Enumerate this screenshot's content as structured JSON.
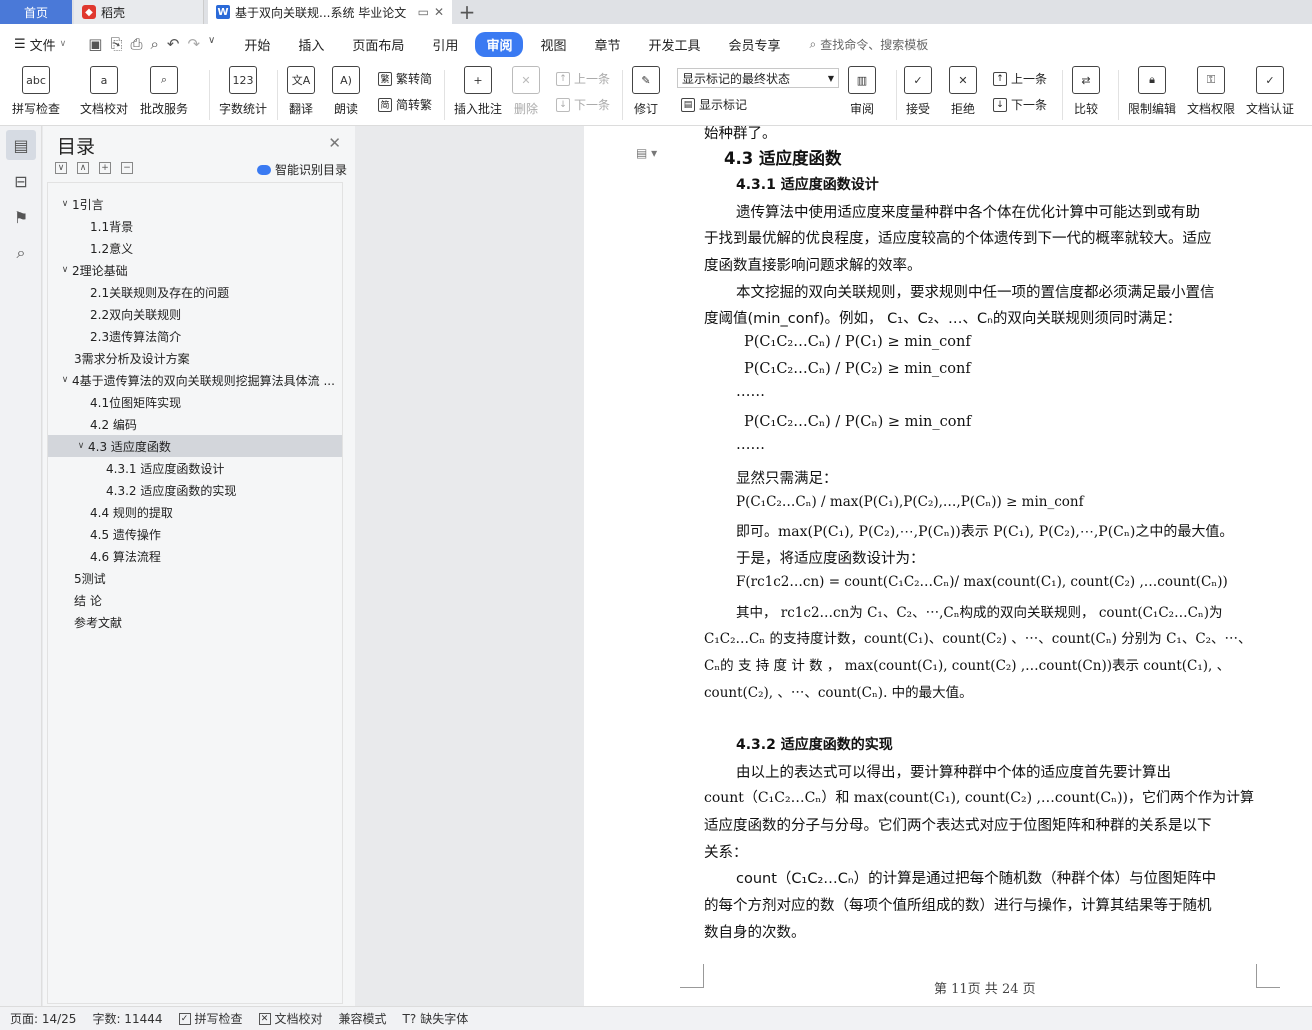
{
  "tabs": {
    "home": "首页",
    "daoke": "稻壳",
    "doc": "基于双向关联规...系统 毕业论文",
    "add": "+"
  },
  "menu": {
    "file": "文件",
    "tabs": [
      "开始",
      "插入",
      "页面布局",
      "引用",
      "审阅",
      "视图",
      "章节",
      "开发工具",
      "会员专享"
    ],
    "search": "查找命令、搜索模板"
  },
  "ribbon": {
    "spell": "拼写检查",
    "proof": "文档校对",
    "revise_service": "批改服务",
    "wordcount": "字数统计",
    "translate": "翻译",
    "read": "朗读",
    "to_trad": "繁转简",
    "to_simp": "简转繁",
    "insert_comment": "插入批注",
    "delete": "删除",
    "prev": "上一条",
    "next": "下一条",
    "revise": "修订",
    "markup_select": "显示标记的最终状态",
    "show_markup": "显示标记",
    "review": "审阅",
    "accept": "接受",
    "reject": "拒绝",
    "prev2": "上一条",
    "next2": "下一条",
    "compare": "比较",
    "restrict": "限制编辑",
    "rights": "文档权限",
    "certify": "文档认证"
  },
  "toc": {
    "title": "目录",
    "smart": "智能识别目录",
    "items": [
      {
        "label": "1引言"
      },
      {
        "label": "1.1背景"
      },
      {
        "label": "1.2意义"
      },
      {
        "label": "2理论基础"
      },
      {
        "label": "2.1关联规则及存在的问题"
      },
      {
        "label": "2.2双向关联规则"
      },
      {
        "label": "2.3遗传算法简介"
      },
      {
        "label": "3需求分析及设计方案"
      },
      {
        "label": "4基于遗传算法的双向关联规则挖掘算法具体流 ..."
      },
      {
        "label": "4.1位图矩阵实现"
      },
      {
        "label": "4.2  编码"
      },
      {
        "label": "4.3  适应度函数"
      },
      {
        "label": "4.3.1  适应度函数设计"
      },
      {
        "label": "4.3.2  适应度函数的实现"
      },
      {
        "label": "4.4  规则的提取"
      },
      {
        "label": "4.5  遗传操作"
      },
      {
        "label": "4.6  算法流程"
      },
      {
        "label": "5测试"
      },
      {
        "label": "结      论"
      },
      {
        "label": "参考文献"
      }
    ]
  },
  "doc": {
    "top_cut": "始种群了。",
    "h_43": "4.3  适应度函数",
    "h_431": "4.3.1 适应度函数设计",
    "p1_l1": "遗传算法中使用适应度来度量种群中各个体在优化计算中可能达到或有助",
    "p1_l2": "于找到最优解的优良程度，适应度较高的个体遗传到下一代的概率就较大。适应",
    "p1_l3": "度函数直接影响问题求解的效率。",
    "p2_l1": "本文挖掘的双向关联规则，要求规则中任一项的置信度都必须满足最小置信",
    "p2_l2": "度阈值(min_conf)。例如，  C₁、C₂、…、Cₙ的双向关联规则须同时满足：",
    "f1": "P(C₁C₂…Cₙ) / P(C₁)  ≥  min_conf",
    "f2": "P(C₁C₂…Cₙ) / P(C₂)  ≥  min_conf",
    "dots1": "……",
    "f3": "P(C₁C₂…Cₙ) / P(Cₙ)  ≥  min_conf",
    "dots2": "……",
    "p3": "显然只需满足：",
    "f4": "P(C₁C₂…Cₙ) / max(P(C₁),P(C₂),…,P(Cₙ))  ≥  min_conf",
    "p4": "即可。max(P(C₁), P(C₂),⋯,P(Cₙ))表示 P(C₁), P(C₂),⋯,P(Cₙ)之中的最大值。",
    "p5": "于是，将适应度函数设计为：",
    "f5": "F(rc1c2…cn) = count(C₁C₂…Cₙ)/ max(count(C₁), count(C₂) ,…count(Cₙ))",
    "p6_l1": "其中，   rc1c2…cn为 C₁、C₂、⋯,Cₙ构成的双向关联规则， count(C₁C₂…Cₙ)为",
    "p6_l2": "C₁C₂…Cₙ 的支持度计数，count(C₁)、count(C₂) 、⋯、count(Cₙ) 分别为 C₁、C₂、⋯、",
    "p6_l3": "Cₙ的 支 持 度 计 数 ，    max(count(C₁), count(C₂) ,…count(Cn))表示 count(C₁), 、",
    "p6_l4": "count(C₂), 、⋯、count(Cₙ). 中的最大值。",
    "h_432": "4.3.2 适应度函数的实现",
    "p7_l1": "由以上的表达式可以得出，要计算种群中个体的适应度首先要计算出",
    "p7_l2": "count（C₁C₂…Cₙ）和 max(count(C₁), count(C₂) ,…count(Cₙ))，它们两个作为计算",
    "p7_l3": "适应度函数的分子与分母。它们两个表达式对应于位图矩阵和种群的关系是以下",
    "p7_l4": "关系：",
    "p8_l1": "count（C₁C₂…Cₙ）的计算是通过把每个随机数（种群个体）与位图矩阵中",
    "p8_l2": "的每个方剂对应的数（每项个值所组成的数）进行与操作，计算其结果等于随机",
    "p8_l3": "数自身的次数。",
    "footer": "第 11页  共 24 页"
  },
  "status": {
    "page": "页面: 14/25",
    "words": "字数: 11444",
    "spell": "拼写检查",
    "proof": "文档校对",
    "compat": "兼容模式",
    "missing_font": "缺失字体"
  }
}
